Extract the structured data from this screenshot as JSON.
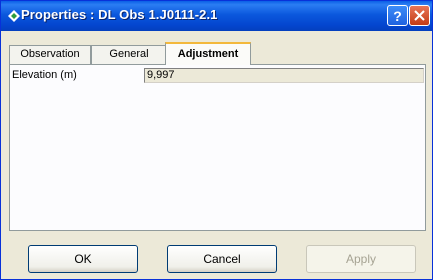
{
  "window": {
    "title": "Properties : DL Obs 1.J0111-2.1",
    "help_label": "?",
    "close_label": "✕"
  },
  "tabs": [
    {
      "label": "Observation",
      "active": false
    },
    {
      "label": "General",
      "active": false
    },
    {
      "label": "Adjustment",
      "active": true
    }
  ],
  "properties": [
    {
      "label": "Elevation (m)",
      "value": "9,997"
    }
  ],
  "buttons": {
    "ok": "OK",
    "cancel": "Cancel",
    "apply": "Apply"
  },
  "colors": {
    "titlebar": "#0b58dd",
    "dialog_bg": "#ece9d8",
    "active_tab_accent": "#f3b83c"
  },
  "icons": {
    "title": "diamond-icon",
    "help": "help-icon",
    "close": "close-icon"
  }
}
